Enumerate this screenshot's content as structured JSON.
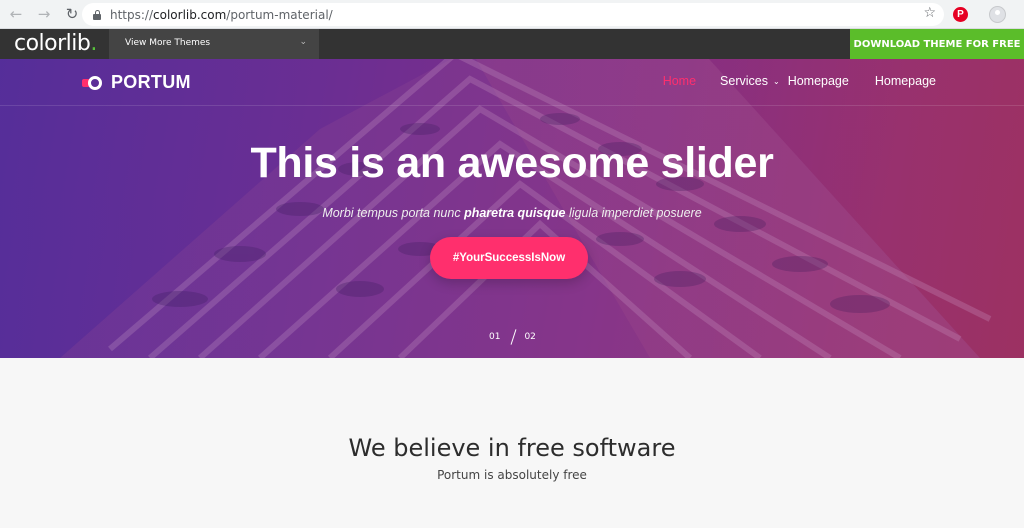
{
  "browser": {
    "url_prefix": "https://",
    "url_host": "colorlib.com",
    "url_path": "/portum-material/",
    "back_icon": "arrow-left-icon",
    "forward_icon": "arrow-right-icon",
    "reload_icon": "reload-icon",
    "bookmark_icon": "star-icon",
    "extension_label": "P"
  },
  "topbar": {
    "logo_text": "colorlib",
    "logo_dot": ".",
    "themes_dropdown": "View More Themes",
    "download_button": "DOWNLOAD THEME FOR FREE",
    "accent_color": "#5bbd2a"
  },
  "site": {
    "brand": "PORTUM",
    "menu": [
      {
        "label": "Home",
        "active": true
      },
      {
        "label": "Services",
        "has_dropdown": true
      },
      {
        "label": "Homepage"
      },
      {
        "label": "Homepage"
      }
    ],
    "accent_color": "#ff2f6d"
  },
  "hero": {
    "title": "This is an awesome slider",
    "subtitle_pre": "Morbi tempus porta nunc ",
    "subtitle_bold": "pharetra quisque",
    "subtitle_post": " ligula imperdiet posuere",
    "cta": "#YourSuccessIsNow",
    "slide_current": "01",
    "slide_total": "02"
  },
  "section": {
    "title": "We believe in free software",
    "subtitle": "Portum is absolutely free"
  }
}
